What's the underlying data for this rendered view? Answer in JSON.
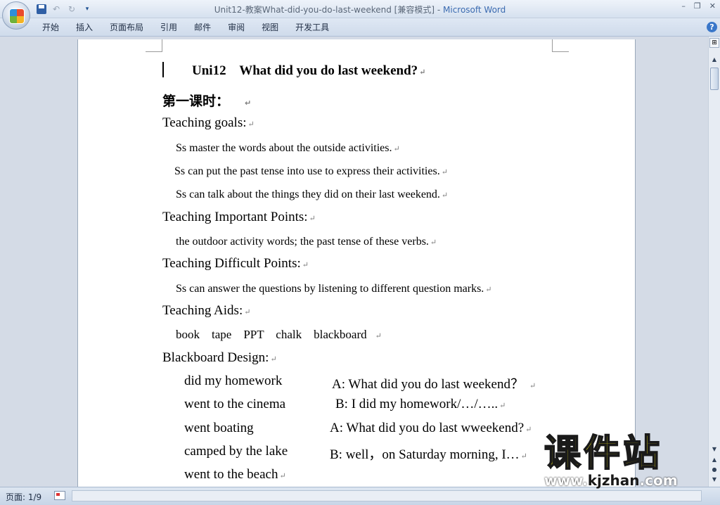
{
  "window": {
    "title": "Unit12-教案What-did-you-do-last-weekend [兼容模式]",
    "separator": " - ",
    "app": "Microsoft Word"
  },
  "ribbon": {
    "tabs": [
      "开始",
      "插入",
      "页面布局",
      "引用",
      "邮件",
      "审阅",
      "视图",
      "开发工具"
    ]
  },
  "document": {
    "title": "Uni12    What did you do last weekend?",
    "lesson": "第一课时：",
    "goals_heading": "Teaching goals:",
    "goals": [
      "Ss master the words about the outside activities.",
      "Ss can put the past tense into use to express their activities.",
      "Ss can talk about the things they did on their last weekend."
    ],
    "important_heading": "Teaching Important Points:",
    "important": "the outdoor activity words; the past tense of these verbs.",
    "difficult_heading": "Teaching Difficult Points:",
    "difficult": "Ss can answer the questions by listening to different question marks.",
    "aids_heading": "Teaching Aids:",
    "aids": "book    tape    PPT    chalk    blackboard",
    "design_heading": "Blackboard Design:",
    "design_left": [
      "did my homework",
      "went to the cinema",
      "went boating",
      "camped by the lake",
      "went to the beach"
    ],
    "design_right": [
      "A: What did you do last weekend？",
      "B: I did my homework/…/…..",
      "A: What did you do last wweekend?",
      "B: well，on Saturday morning, I…"
    ]
  },
  "status": {
    "page": "页面: 1/9"
  },
  "watermark": {
    "cn": "课件站",
    "url_1": "www.",
    "url_2": "kjzhan",
    "url_3": ".com"
  }
}
